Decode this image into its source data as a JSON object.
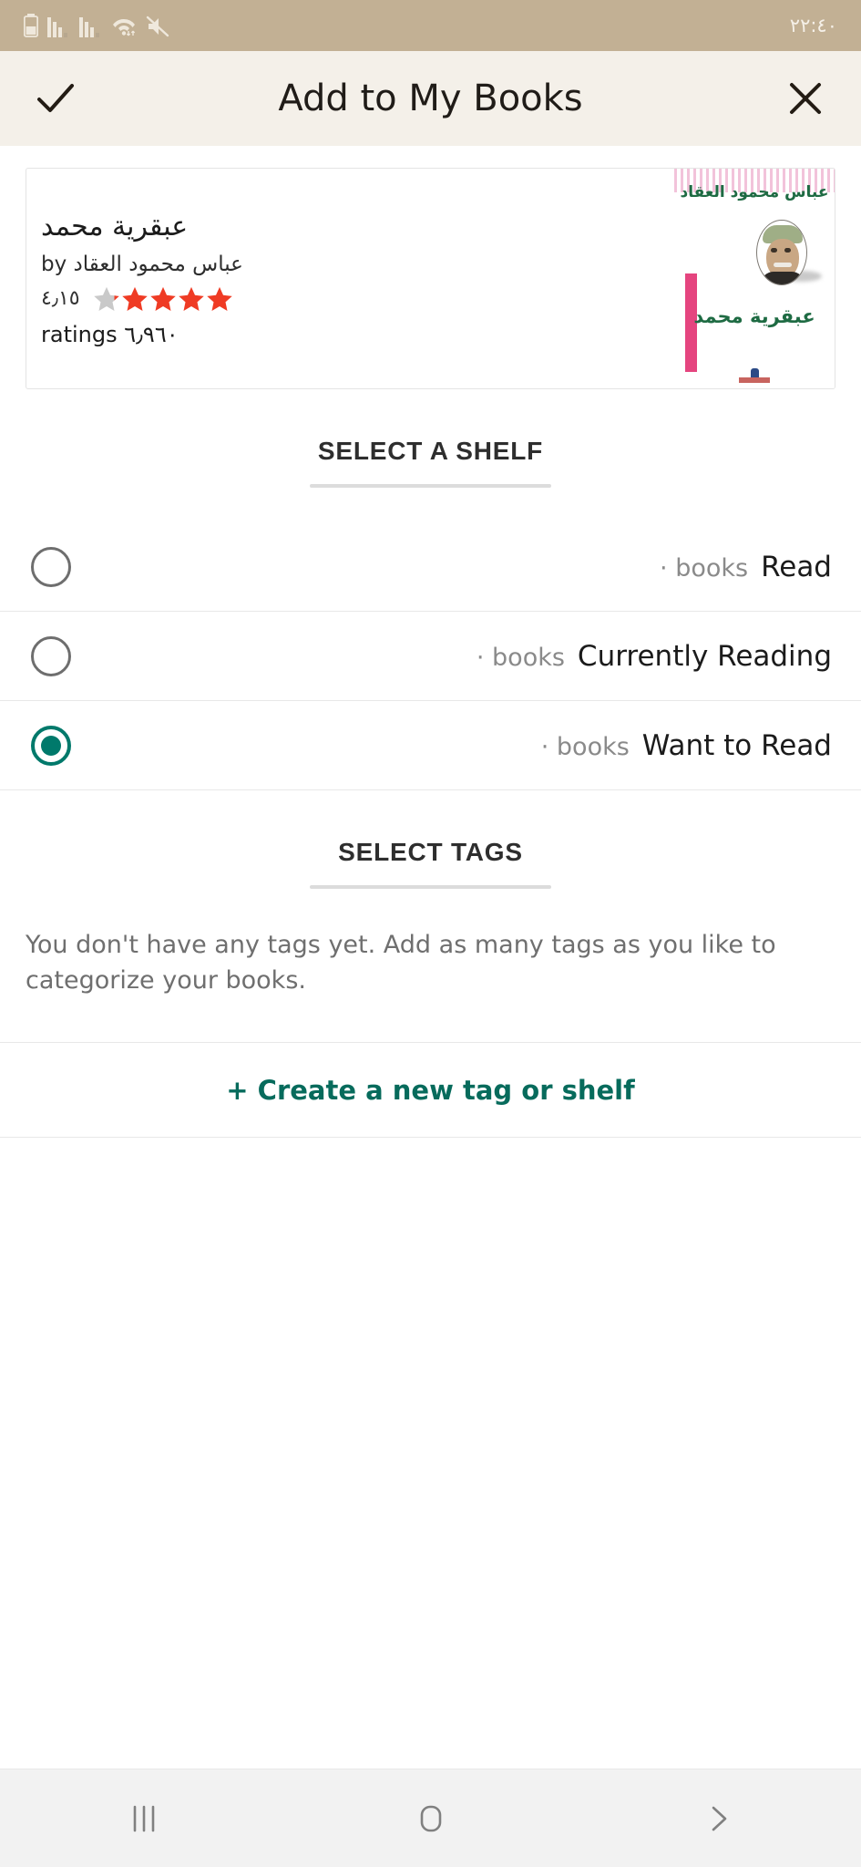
{
  "status_bar": {
    "time": "٢٢:٤٠",
    "background_color": "#c2b094",
    "icons": [
      "battery-icon",
      "signal-sim1-icon",
      "signal-sim2-icon",
      "wifi-icon",
      "mute-icon"
    ]
  },
  "app_bar": {
    "title": "Add to My Books",
    "confirm_icon": "check-icon",
    "close_icon": "close-icon",
    "background_color": "#f4f0e9"
  },
  "book": {
    "title": "عبقرية محمد",
    "author_line": "عباس محمود العقاد by",
    "rating_value": "٤٫١٥",
    "ratings_count": "٦٫٩٦٠ ratings",
    "stars_total": 5,
    "stars_filled": 4,
    "star_filled_color": "#ef3b24",
    "star_empty_color": "#c9c9c9",
    "cover": {
      "author_text": "عباس محمود العقاد",
      "title_text": "عبقرية محمد",
      "accent_color": "#e5457f",
      "text_color": "#1e6b43"
    }
  },
  "shelf_section": {
    "heading": "SELECT A SHELF",
    "items": [
      {
        "name": "Read",
        "count_label": "· books",
        "selected": false
      },
      {
        "name": "Currently Reading",
        "count_label": "· books",
        "selected": false
      },
      {
        "name": "Want to Read",
        "count_label": "· books",
        "selected": true
      }
    ]
  },
  "tags_section": {
    "heading": "SELECT TAGS",
    "empty_message": "You don't have any tags yet. Add as many tags as you like to categorize your books.",
    "create_label": "+ Create a new tag or shelf",
    "accent_color": "#076b5c"
  },
  "nav_bar": {
    "recents_icon": "recents-icon",
    "home_icon": "home-icon",
    "back_icon": "back-chevron-icon"
  }
}
